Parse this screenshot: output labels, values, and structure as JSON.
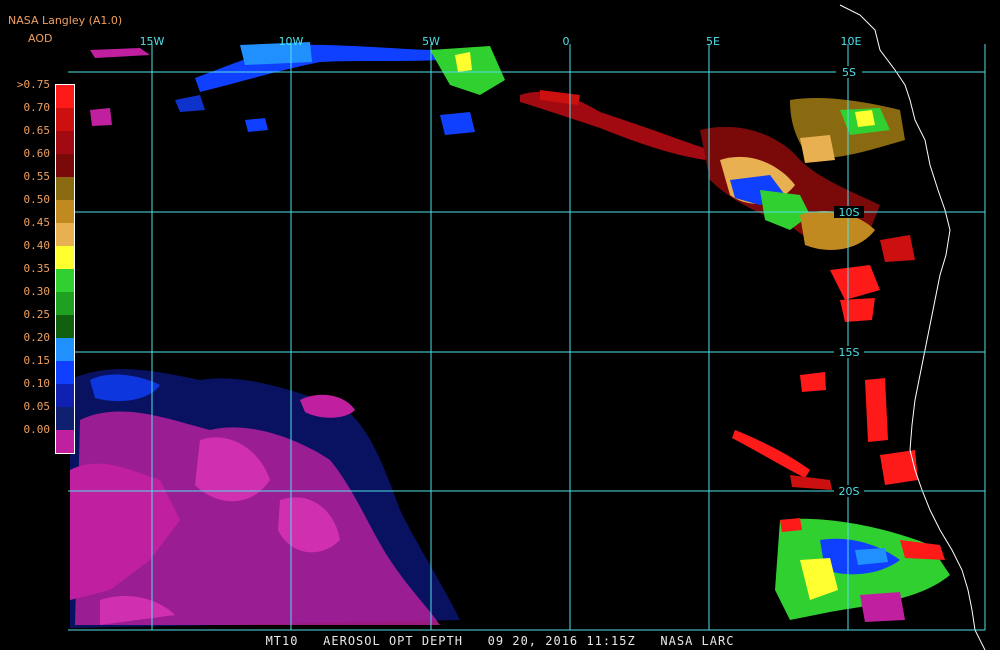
{
  "header": {
    "source": "NASA Langley (A1.0)",
    "variable": "AOD"
  },
  "colorbar": {
    "labels": [
      ">0.75",
      "0.70",
      "0.65",
      "0.60",
      "0.55",
      "0.50",
      "0.45",
      "0.40",
      "0.35",
      "0.30",
      "0.25",
      "0.20",
      "0.15",
      "0.10",
      "0.05",
      "0.00"
    ],
    "colors": [
      "#ff1a1a",
      "#cc1010",
      "#a00a10",
      "#7a0a0a",
      "#8a6a10",
      "#c08a20",
      "#e8b050",
      "#ffff30",
      "#30d030",
      "#20a020",
      "#106010",
      "#2090ff",
      "#1040ff",
      "#1020b0",
      "#102070",
      "#c020a0"
    ]
  },
  "grid": {
    "lon_labels": [
      "15W",
      "10W",
      "5W",
      "0",
      "5E",
      "10E"
    ],
    "lat_labels": [
      "5S",
      "10S",
      "15S",
      "20S"
    ]
  },
  "footer": {
    "product": "MT10",
    "title": "AEROSOL OPT DEPTH",
    "datetime": "09 20, 2016 11:15Z",
    "credit": "NASA LARC"
  }
}
